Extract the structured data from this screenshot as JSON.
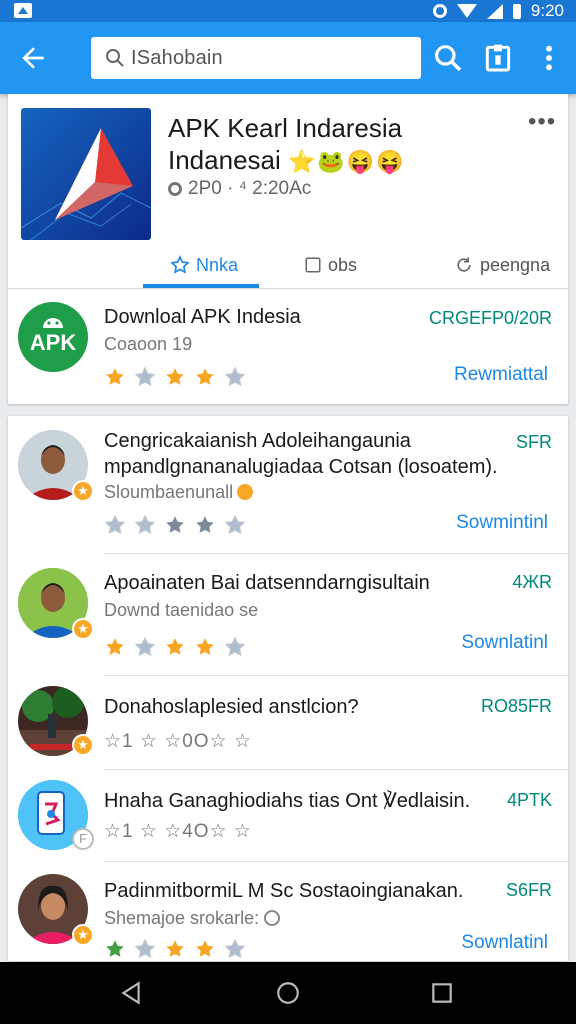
{
  "status_bar": {
    "time": "9:20"
  },
  "app_bar": {
    "search_text": "ISahobain"
  },
  "hero": {
    "title_line1": "APK Kearl Indaresia",
    "title_line2": "Indanesai",
    "emoji": "⭐🐸😝😝",
    "meta": "2P0 · ⁴ 2:20Ac",
    "more": "•••",
    "tabs": [
      {
        "label": "Nnka",
        "icon": "star-outline-icon"
      },
      {
        "label": "obs",
        "icon": "square-outline-icon"
      },
      {
        "label": "peengna",
        "icon": "refresh-icon"
      }
    ]
  },
  "featured": {
    "logo_text": "APK",
    "title": "Downloal APK Indesia",
    "subtitle": "Coaoon 19",
    "size": "CRGEFP0/20R",
    "action": "Rewmiattal",
    "stars": [
      1,
      0,
      1,
      1,
      0
    ]
  },
  "list": [
    {
      "title": "Cengricakaianish Adoleihangaunia mpandlgnananalugiadaa Cotsan (losoatem).",
      "subtitle": "Sloumbaenunall",
      "size": "SFR",
      "action": "Sowmintinl",
      "stars": [
        0,
        0,
        2,
        2,
        0
      ]
    },
    {
      "title": "Apoainaten Bai datsenndarngisultain",
      "subtitle": "Downd taenidao se",
      "size": "4ЖR",
      "action": "Sownlatinl",
      "stars": [
        1,
        0,
        1,
        1,
        0
      ]
    },
    {
      "title": "Donahoslaplesied anstlcion?",
      "rating": "☆1 ☆ ☆0O☆ ☆",
      "size": "RO85FR",
      "action": "",
      "stars": []
    },
    {
      "title": "Hnaha Ganaghiodiahs tias Ont ℣edlaisin.",
      "rating": "☆1 ☆ ☆4O☆ ☆",
      "size": "4PTK",
      "action": "",
      "stars": []
    },
    {
      "title": "PadinmitbormiL M Sc Sostaoingianakan.",
      "subtitle": "Shemajoe srokarle:",
      "size": "S6FR",
      "action": "Sownlatinl",
      "stars": [
        3,
        0,
        1,
        1,
        0
      ]
    }
  ],
  "colors": {
    "primary": "#2196f3",
    "status_bar": "#1976d2",
    "star_gold": "#f6a623",
    "star_grey": "#9fb0c8",
    "size_green": "#00897b",
    "action_blue": "#1e88e5"
  }
}
